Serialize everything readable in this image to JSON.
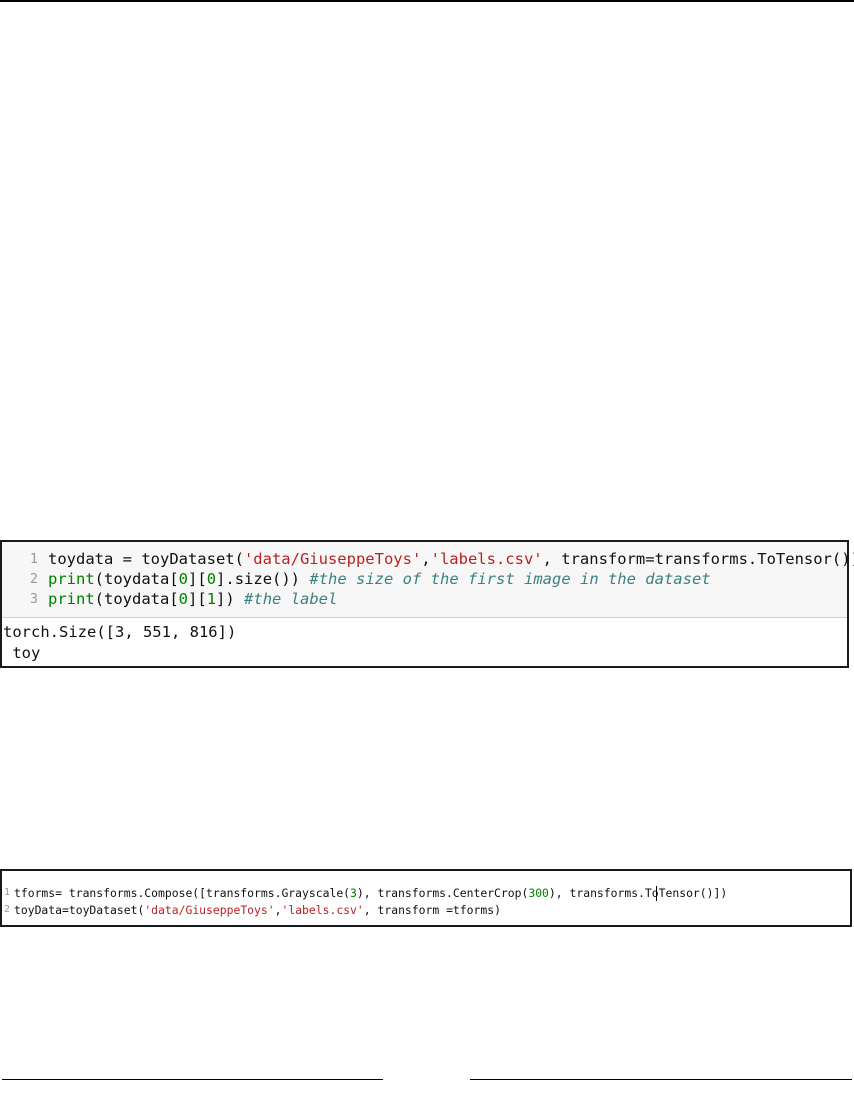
{
  "cell1": {
    "input_lines": [
      {
        "num": "1",
        "segments": [
          {
            "t": "toydata = toyDataset(",
            "c": ""
          },
          {
            "t": "'data/GiuseppeToys'",
            "c": "str"
          },
          {
            "t": ",",
            "c": ""
          },
          {
            "t": "'labels.csv'",
            "c": "str"
          },
          {
            "t": ", transform=transforms.ToTensor())",
            "c": ""
          }
        ]
      },
      {
        "num": "2",
        "segments": [
          {
            "t": "print",
            "c": "kw"
          },
          {
            "t": "(toydata[",
            "c": ""
          },
          {
            "t": "0",
            "c": "num"
          },
          {
            "t": "][",
            "c": ""
          },
          {
            "t": "0",
            "c": "num"
          },
          {
            "t": "].size()) ",
            "c": ""
          },
          {
            "t": "#the size of the first image in the dataset",
            "c": "cm"
          }
        ]
      },
      {
        "num": "3",
        "segments": [
          {
            "t": "print",
            "c": "kw"
          },
          {
            "t": "(toydata[",
            "c": ""
          },
          {
            "t": "0",
            "c": "num"
          },
          {
            "t": "][",
            "c": ""
          },
          {
            "t": "1",
            "c": "num"
          },
          {
            "t": "]) ",
            "c": ""
          },
          {
            "t": "#the label",
            "c": "cm"
          }
        ]
      }
    ],
    "output_lines": [
      "torch.Size([3, 551, 816])",
      " toy"
    ]
  },
  "cell2": {
    "input_lines": [
      {
        "num": "1",
        "segments": [
          {
            "t": "tforms= transforms.Compose([transforms.Grayscale(",
            "c": ""
          },
          {
            "t": "3",
            "c": "num"
          },
          {
            "t": "), transforms.CenterCrop(",
            "c": ""
          },
          {
            "t": "300",
            "c": "num"
          },
          {
            "t": "), transforms.ToTensor()])",
            "c": ""
          }
        ]
      },
      {
        "num": "2",
        "segments": [
          {
            "t": "toyData=toyDataset(",
            "c": ""
          },
          {
            "t": "'data/GiuseppeToys'",
            "c": "str"
          },
          {
            "t": ",",
            "c": ""
          },
          {
            "t": "'labels.csv'",
            "c": "str"
          },
          {
            "t": ", transform =tforms)",
            "c": ""
          }
        ]
      }
    ]
  }
}
